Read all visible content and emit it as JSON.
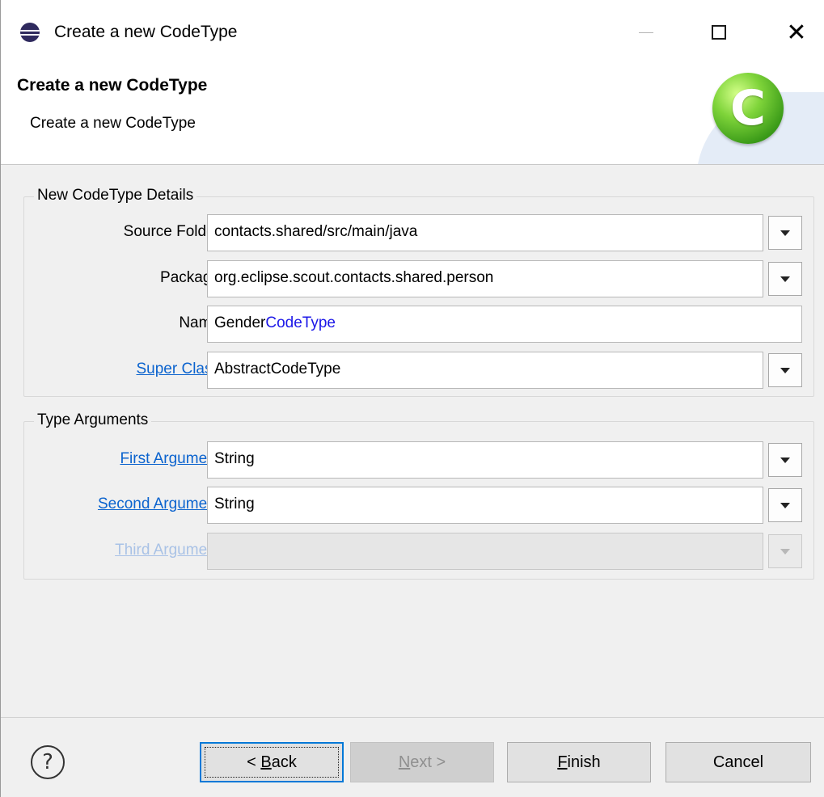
{
  "window": {
    "title": "Create a new CodeType"
  },
  "banner": {
    "title": "Create a new CodeType",
    "subtitle": "Create a new CodeType",
    "logo_letter": "C"
  },
  "details_group": {
    "legend": "New CodeType Details",
    "source_folder": {
      "label": "Source Folder",
      "value": "contacts.shared/src/main/java"
    },
    "package": {
      "label": "Package",
      "value": "org.eclipse.scout.contacts.shared.person"
    },
    "name": {
      "label": "Name",
      "value_prefix": "Gender",
      "value_suffix": "CodeType"
    },
    "super_class": {
      "label": "Super Class",
      "value": "AbstractCodeType"
    }
  },
  "type_args_group": {
    "legend": "Type Arguments",
    "first_argument": {
      "label": "First Argument",
      "value": "String"
    },
    "second_argument": {
      "label": "Second Argument",
      "value": "String"
    },
    "third_argument": {
      "label": "Third Argument",
      "value": ""
    }
  },
  "footer": {
    "help_glyph": "?",
    "back": {
      "prefix": "< ",
      "mnemonic": "B",
      "rest": "ack"
    },
    "next": {
      "mnemonic": "N",
      "rest": "ext >"
    },
    "finish": {
      "mnemonic": "F",
      "rest": "inish"
    },
    "cancel": "Cancel"
  },
  "colors": {
    "link": "#0b63ce",
    "link_disabled": "#a9c2e6",
    "name_suffix": "#1c17e8",
    "focus_border": "#0078d7",
    "logo_green": "#7fd43a"
  }
}
